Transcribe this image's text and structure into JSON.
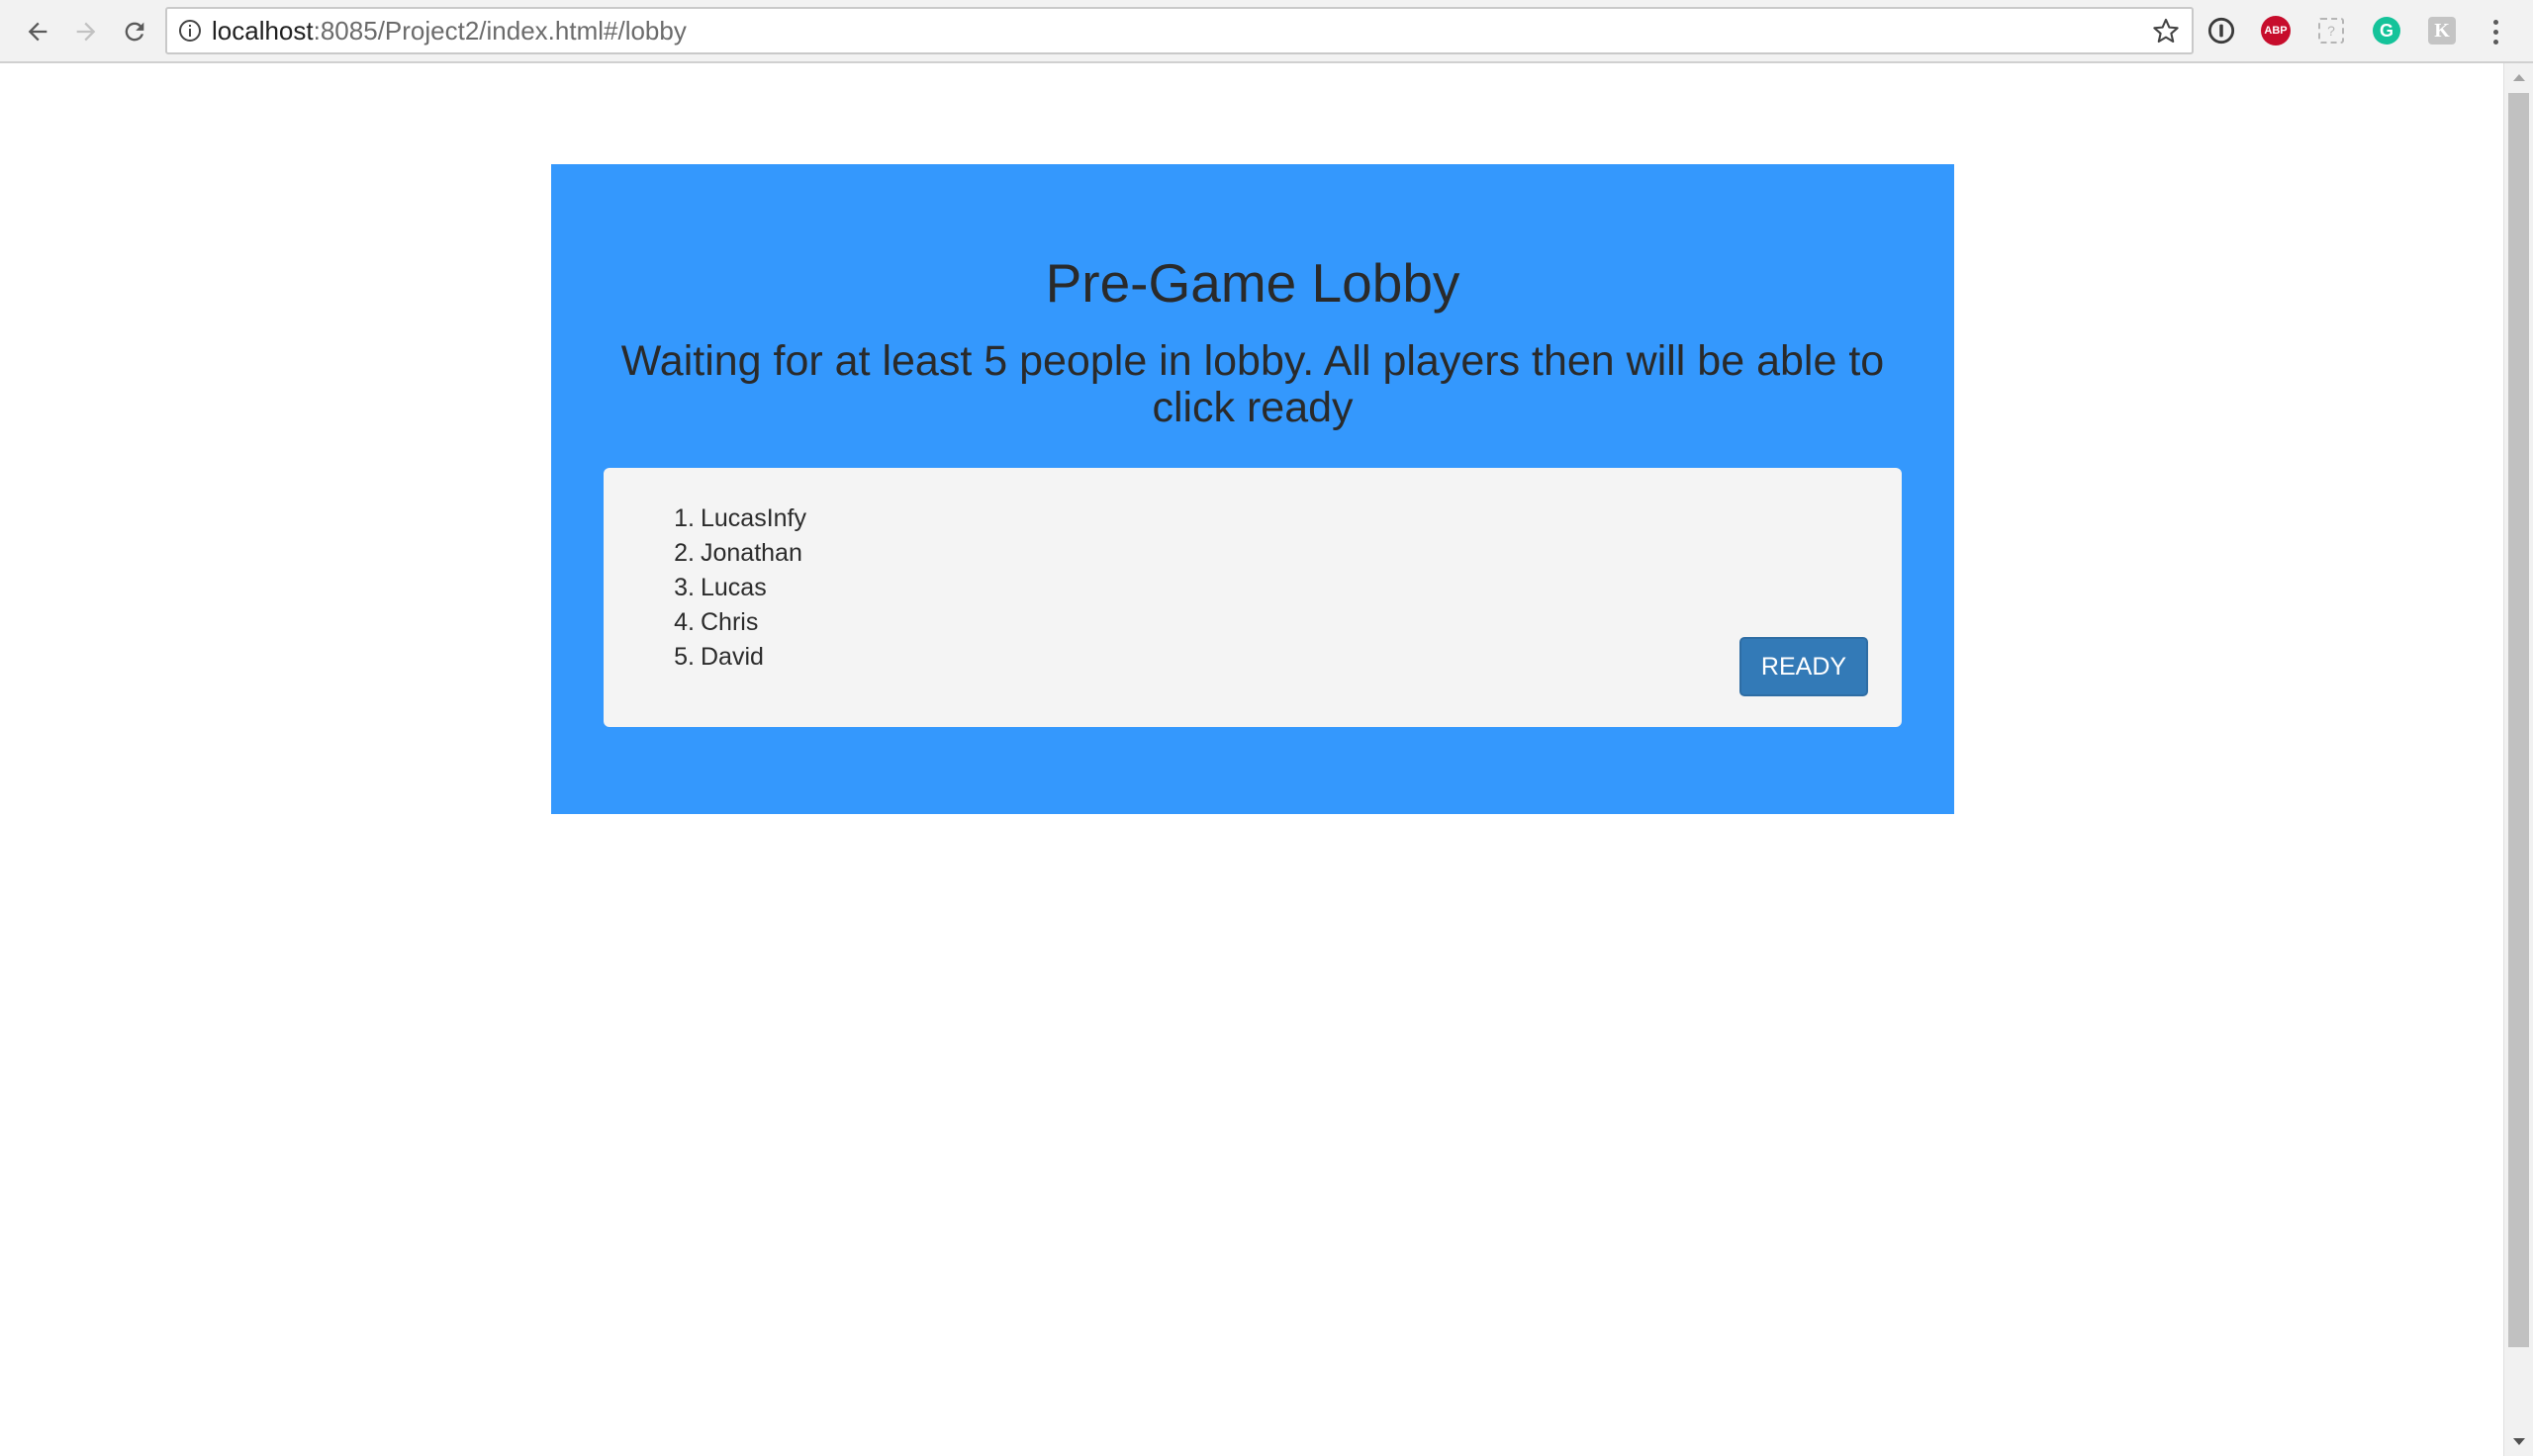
{
  "browser": {
    "url_host": "localhost",
    "url_rest": ":8085/Project2/index.html#/lobby",
    "extensions": {
      "abp_label": "ABP",
      "grammarly_label": "G",
      "k_label": "K",
      "dash_label": "?"
    },
    "icons": [
      "back-arrow-icon",
      "forward-arrow-icon",
      "reload-icon",
      "info-icon",
      "star-icon",
      "password-manager-icon",
      "adblock-icon",
      "extension-placeholder-icon",
      "grammarly-icon",
      "k-extension-icon",
      "menu-dots-icon"
    ]
  },
  "lobby": {
    "title": "Pre-Game Lobby",
    "subtitle": "Waiting for at least 5 people in lobby. All players then will be able to click ready",
    "players": [
      {
        "num": "1.",
        "name": "LucasInfy"
      },
      {
        "num": "2.",
        "name": "Jonathan"
      },
      {
        "num": "3.",
        "name": "Lucas"
      },
      {
        "num": "4.",
        "name": "Chris"
      },
      {
        "num": "5.",
        "name": "David"
      }
    ],
    "ready_label": "READY"
  },
  "colors": {
    "panel": "#3498fd",
    "card": "#f4f4f4",
    "button": "#337ab7"
  }
}
